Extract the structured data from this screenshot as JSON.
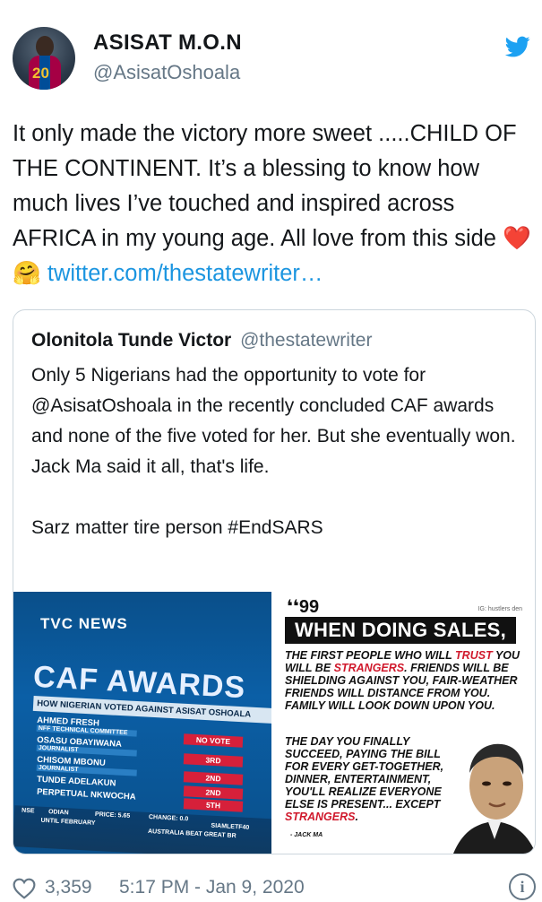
{
  "header": {
    "display_name": "ASISAT M.O.N",
    "handle": "@AsisatOshoala",
    "avatar_number": "20",
    "brand_icon": "twitter-bird-icon",
    "brand_color": "#1da1f2"
  },
  "tweet": {
    "text": "It only made the victory more sweet .....CHILD OF THE CONTINENT. It’s a blessing to know how much lives I’ve touched and inspired across AFRICA in my young age. All love from this side",
    "emojis": "❤️🤗",
    "link": "twitter.com/thestatewriter…",
    "link_color": "#1b95e0"
  },
  "quoted": {
    "author": "Olonitola Tunde Victor",
    "handle": "@thestatewriter",
    "lines": [
      "Only 5 Nigerians had the opportunity to vote for @AsisatOshoala in the recently concluded CAF awards and none of the five voted for her. But she eventually won.",
      "Jack Ma said it all, that's life.",
      "",
      "Sarz matter tire person #EndSARS"
    ],
    "media_left": {
      "channel": "TVC NEWS",
      "title": "CAF AWARDS",
      "subtitle": "HOW NIGERIAN VOTED AGAINST ASISAT OSHOALA",
      "rows": [
        {
          "name": "AHMED FRESH",
          "role": "NFF TECHNICAL COMMITTEE",
          "vote": "NO VOTE"
        },
        {
          "name": "OSASU OBAYIWANA",
          "role": "JOURNALIST",
          "vote": "3RD"
        },
        {
          "name": "CHISOM MBONU",
          "role": "JOURNALIST",
          "vote": "2ND"
        },
        {
          "name": "TUNDE ADELAKUN",
          "role": "",
          "vote": "2ND"
        },
        {
          "name": "PERPETUAL NKWOCHA",
          "role": "",
          "vote": "5TH"
        }
      ],
      "ticker": [
        "NSE",
        "ODIAN",
        "PRICE: 5.65",
        "CHANGE: 0.0",
        "SIAMLETF40",
        "UNTIL FEBRUARY",
        "AUSTRALIA BEAT GREAT BR"
      ]
    },
    "media_right": {
      "quote_mark": "❛❛99",
      "ig_tag": "IG: hustlers den",
      "headline": "WHEN DOING SALES,",
      "paragraph_1": "THE FIRST PEOPLE WHO WILL TRUST YOU WILL BE STRANGERS. FRIENDS WILL BE SHIELDING AGAINST YOU, FAIR-WEATHER FRIENDS WILL DISTANCE FROM YOU. FAMILY WILL LOOK DOWN UPON YOU.",
      "paragraph_2": "THE DAY YOU FINALLY SUCCEED, PAYING THE BILL FOR EVERY GET-TOGETHER, DINNER, ENTERTAINMENT, YOU'LL REALIZE EVERYONE ELSE IS PRESENT... EXCEPT STRANGERS.",
      "signature": "- JACK MA",
      "accent": "#d0192c"
    }
  },
  "footer": {
    "likes": "3,359",
    "datetime": "5:17 PM - Jan 9, 2020",
    "like_icon": "heart-outline-icon",
    "info_icon": "info-icon"
  }
}
